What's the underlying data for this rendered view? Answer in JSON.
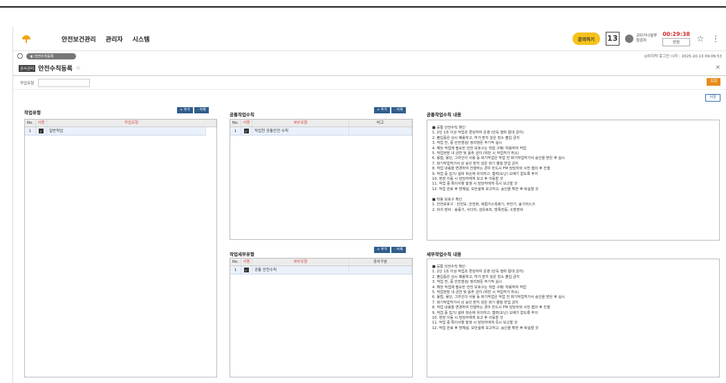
{
  "header": {
    "nav": [
      "안전보건관리",
      "관리자",
      "시스템"
    ],
    "inquiry_label": "문의하기",
    "calendar_day": "13",
    "user_line1": "코타키나발루",
    "user_line2": "점검자",
    "timer": "00:29:38",
    "extend_label": "연장",
    "star_icon": "☆",
    "more_icon": "⋮"
  },
  "tabbar": {
    "tab_label": "◐ 안전수칙등록",
    "last_login": "◎마지막 로그인 시각 : 2025-10-13 09:06:53"
  },
  "page": {
    "badge": "공사관리",
    "title": "안전수칙등록",
    "star": "☆",
    "close": "×"
  },
  "filter": {
    "label": "작업유형",
    "value": "",
    "search_label": "조회",
    "save_label": "저장"
  },
  "work_type": {
    "title": "작업유형",
    "add": "+ 추가",
    "delete": "- 삭제",
    "columns": [
      "No.",
      "사용",
      "작업유형"
    ],
    "rows": [
      {
        "no": "1",
        "name": "일반작업"
      }
    ]
  },
  "common_rule": {
    "title": "공통작업수칙",
    "add": "+ 추가",
    "delete": "- 삭제",
    "columns": [
      "No.",
      "사용",
      "세부유형",
      "비고"
    ],
    "rows": [
      {
        "no": "1",
        "name": "작업현 공통안전 수칙",
        "note": ""
      }
    ]
  },
  "detail_type": {
    "title": "작업세부유형",
    "add": "+ 추가",
    "delete": "- 삭제",
    "columns": [
      "No.",
      "사용",
      "세부유형",
      "공사구분"
    ],
    "rows": [
      {
        "no": "1",
        "name": "공통 안전수칙",
        "note": ""
      }
    ]
  },
  "common_content": {
    "title": "공통작업수칙 내용",
    "text": "■ 공통 안전수칙 확인\n1. 2인 1조 이상 작업조 편성하여 운영 (단독 행위 절대 금지)\n2. 출입증은 상시 패용하고, 허가 받지 않은 장소 출입 금지\n3. 작업 전, 중 안전점검/ 정리정돈 주기적 실시\n4. 해당 작업에 필요한 안전 보호구는 직접 구매/ 착용하여 작업\n5. 작업현장 내 금연 및 음주 금지 (위반 시 작업허가 취소)\n6. 용접, 용단, 그라인더 사용 등 화기작업은 작업 전 화기작업허가서 승인을 받은 후 실시\n7. 화기작업허가서 상 승인 받지 않은 화기 물질 반입 금지\n8. 작업 내용을 변경하여 진행하는 경우 반드시 FM 담당자와 사전 협의 후 진행\n9. 작업 중 집기/ 설비 파손에 유의하고, 협력(도난) 오배기 없도록 주의\n10. 현장 이동 시 담당자에게 보고 후 이동할 것\n11. 작업 중 특이사항 발생 시 담당자에게 즉시 보고할 것\n12. 작업 완료 후 방해설, 보안설에 보고하고, 승인을 확한 후 퇴실할 것\n\n■ 착용 보호구 확인\n1. 안전보호구 : 안전모, 안전화, 복합가스측정기, 무전기, 송기마스크\n2. 비치 장비 : 송풍기, 사다리, 섬유로프, 방폭전등, 소방장비"
  },
  "detail_content": {
    "title": "세부작업수칙 내용",
    "text": "■ 공통 안전수칙 확인\n1. 2인 1조 이상 작업조 편성하여 운영 (단독 행위 절대 금지)\n2. 출입증은 상시 패용하고, 허가 받지 않은 장소 출입 금지\n3. 작업 전, 중 안전점검/ 정리정돈 주기적 실시\n4. 해당 작업에 필요한 안전 보호구는 직접 구매/ 착용하여 작업\n5. 작업현장 내 금연 및 음주 금지 (위반 시 작업허가 취소)\n6. 용접, 용단, 그라인더 사용 등 화기작업은 작업 전 화기작업허가서 승인을 받은 후 실시\n7. 화기작업허가서 상 승인 받지 않은 화기 물질 반입 금지\n8. 작업 내용을 변경하여 진행하는 경우 반드시 FM 담당자와 사전 협의 후 진행\n9. 작업 중 집기/ 설비 파손에 유의하고, 협력(도난) 오배기 없도록 주의\n10. 현장 이동 시 담당자에게 보고 후 이동할 것\n11. 작업 중 특이사항 발생 시 담당자에게 즉시 보고할 것\n12. 작업 완료 후 방해설, 보안설에 보고하고, 승인을 확한 후 퇴실할 것"
  },
  "colors": {
    "accent": "#f6c21b",
    "button_blue": "#2f5d8c",
    "search_orange": "#e78b1a",
    "timer_red": "#d32f2f"
  }
}
